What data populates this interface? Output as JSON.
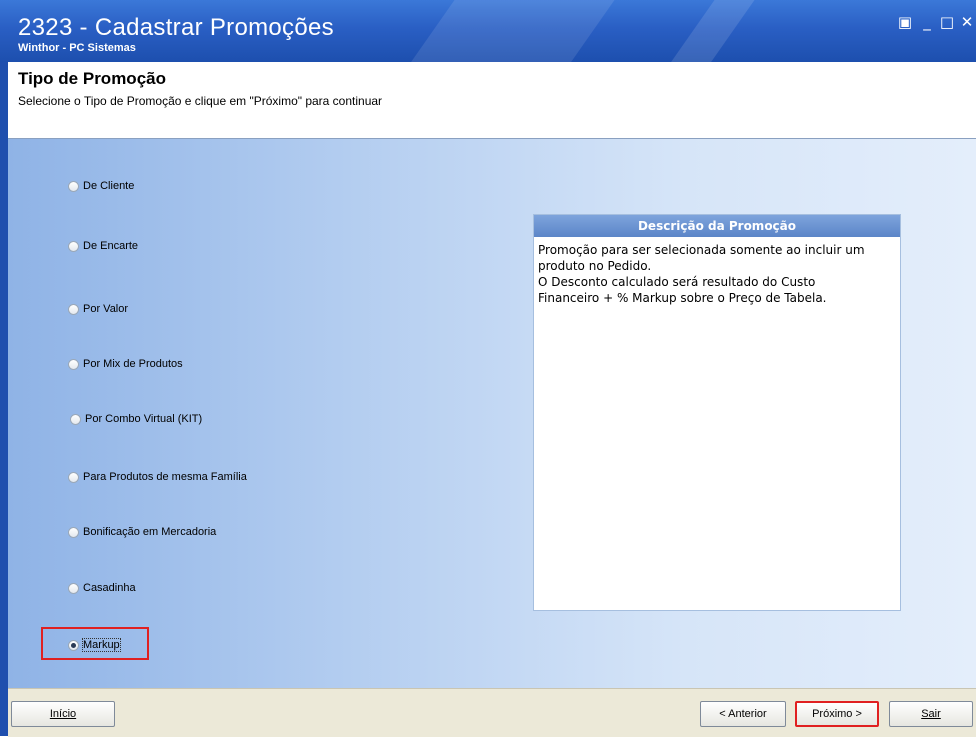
{
  "window": {
    "title": "2323 - Cadastrar Promoções",
    "subtitle": "Winthor - PC Sistemas",
    "controls": {
      "restore": "▣",
      "minimize": "_",
      "maximize": "□",
      "close": "✕"
    }
  },
  "header": {
    "title": "Tipo de Promoção",
    "subtitle": "Selecione o Tipo de Promoção e clique em \"Próximo\" para continuar"
  },
  "promotion_types": {
    "selected": "Markup",
    "options": [
      {
        "label": "De Cliente",
        "checked": false
      },
      {
        "label": "De Encarte",
        "checked": false
      },
      {
        "label": "Por Valor",
        "checked": false
      },
      {
        "label": "Por Mix de Produtos",
        "checked": false
      },
      {
        "label": "Por Combo Virtual (KIT)",
        "checked": false
      },
      {
        "label": "Para Produtos de mesma Família",
        "checked": false
      },
      {
        "label": "Bonificação em Mercadoria",
        "checked": false
      },
      {
        "label": "Casadinha",
        "checked": false
      },
      {
        "label": "Markup",
        "checked": true
      }
    ]
  },
  "description": {
    "header": "Descrição da Promoção",
    "text": "Promoção para ser selecionada somente ao incluir um\nproduto no Pedido.\nO Desconto calculado será resultado do Custo\nFinanceiro + % Markup sobre o Preço de Tabela."
  },
  "footer": {
    "start": "Início",
    "previous": "< Anterior",
    "next": "Próximo >",
    "exit": "Sair"
  },
  "colors": {
    "titlebar": "#2a5fc4",
    "highlight": "#e02020",
    "panel_header": "#5b85c8"
  }
}
